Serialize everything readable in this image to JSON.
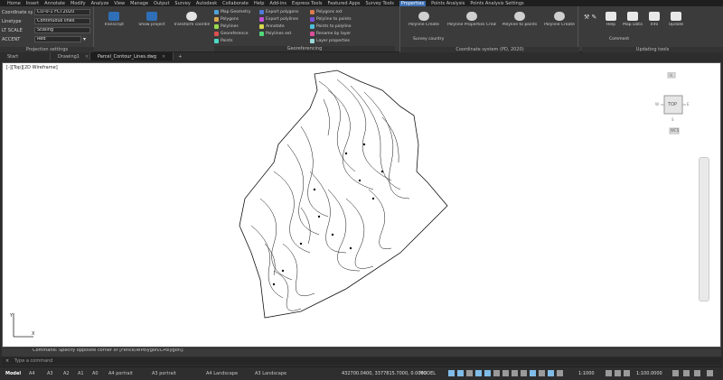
{
  "menubar": {
    "items": [
      "Home",
      "Insert",
      "Annotate",
      "Modify",
      "Analyze",
      "View",
      "Manage",
      "Output",
      "Survey",
      "Autodesk",
      "Collaborate",
      "Help",
      "Add-ins",
      "Express Tools",
      "Featured Apps",
      "Survey Tools",
      "Properties",
      "Points Analysis",
      "Points Analysis Settings"
    ],
    "active_index": 16
  },
  "properties_panel": {
    "rows": [
      {
        "label": "Coordinate sys",
        "value": "CO-0-1 FCI 2020"
      },
      {
        "label": "Linetype",
        "value": "Continuous lines"
      },
      {
        "label": "LT SCALE",
        "value": "Scaling"
      },
      {
        "label": "ACCENT",
        "value": "Red"
      }
    ],
    "title": "Projection settings"
  },
  "ribbon": {
    "big_tools": [
      {
        "label": "Transcript",
        "color": "#2f6fb8"
      },
      {
        "label": "Show project",
        "color": "#2f6fb8"
      },
      {
        "label": "Transform coordinates",
        "color": "#e3e3e3"
      }
    ],
    "small_tools": [
      {
        "label": "Map Geometry",
        "color": "#4fa3d9"
      },
      {
        "label": "Polygons",
        "color": "#d9a84f"
      },
      {
        "label": "Polylines",
        "color": "#9ad94f"
      },
      {
        "label": "Georeference",
        "color": "#d94f4f"
      },
      {
        "label": "Points",
        "color": "#4fd9c4"
      },
      {
        "label": "Export polygons",
        "color": "#4f7ad9"
      },
      {
        "label": "Export polylines",
        "color": "#c44fd9"
      },
      {
        "label": "Annotate",
        "color": "#d9d94f"
      },
      {
        "label": "Polylines ext",
        "color": "#4fd97a"
      },
      {
        "label": "Polygons ext",
        "color": "#d97a4f"
      },
      {
        "label": "Polyline to points",
        "color": "#7a4fd9"
      },
      {
        "label": "Points to polyline",
        "color": "#4fbfd9"
      },
      {
        "label": "Rename by layer",
        "color": "#d94f9a"
      },
      {
        "label": "Layer properties",
        "color": "#9ad9d9"
      }
    ],
    "export_title": "Georeferencing",
    "coords_tools": [
      "Polyline Create",
      "Polyline Properties Create",
      "Polyline to points",
      "Polyline Create"
    ],
    "coords_title": "Coordinate system (PD, 2020)",
    "info_label": "Survey country",
    "help_tools": [
      "Help",
      "Map Data",
      "Info",
      "Update"
    ],
    "help_title": "Updating tools",
    "comment": "Comment"
  },
  "doctabs": {
    "start": "Start",
    "drawing": "Drawing1",
    "active": "Parcel_Contour_Lines.dwg",
    "plus": "+"
  },
  "canvas": {
    "view_label": "[-][Top][2D Wireframe]",
    "viewcube_top": "TOP",
    "viewcube_n": "N",
    "viewcube_s": "S",
    "viewcube_w": "W",
    "viewcube_e": "E",
    "wcs": "WCS"
  },
  "command": {
    "history": "Command: Specify opposite corner or [Fence/WPolygon/CPolygon]:",
    "prompt": "Type a command"
  },
  "statusbar": {
    "layouts": [
      "Model",
      "A4",
      "A3",
      "A2",
      "A1",
      "A0",
      "A4 portrait",
      "A3 portrait",
      "A4 Landscape",
      "A3 Landscape"
    ],
    "coordinates": "432700.0400, 3377815.7000, 0.0000",
    "model_label": "MODEL",
    "scale": "1:1000",
    "scale_value": "1:100.0000"
  }
}
